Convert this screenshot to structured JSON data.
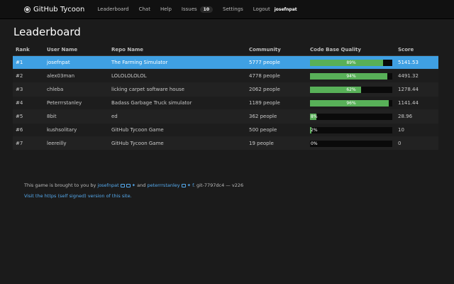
{
  "nav": {
    "brand": "GitHub Tycoon",
    "leaderboard": "Leaderboard",
    "chat": "Chat",
    "help": "Help",
    "issues": "Issues",
    "issues_count": "10",
    "settings": "Settings",
    "logout": "Logout",
    "username": "josefnpat"
  },
  "page_title": "Leaderboard",
  "table": {
    "headers": [
      "Rank",
      "User Name",
      "Repo Name",
      "Community",
      "Code Base Quality",
      "Score"
    ],
    "rows": [
      {
        "rank": "#1",
        "user": "josefnpat",
        "repo": "The Farming Simulator",
        "community": "5777 people",
        "quality": 89,
        "quality_label": "89%",
        "score": "5141.53"
      },
      {
        "rank": "#2",
        "user": "alex03man",
        "repo": "LOLOLOLOLOL",
        "community": "4778 people",
        "quality": 94,
        "quality_label": "94%",
        "score": "4491.32"
      },
      {
        "rank": "#3",
        "user": "chleba",
        "repo": "licking carpet software house",
        "community": "2062 people",
        "quality": 62,
        "quality_label": "62%",
        "score": "1278.44"
      },
      {
        "rank": "#4",
        "user": "Peterrrstanley",
        "repo": "Badass Garbage Truck simulator",
        "community": "1189 people",
        "quality": 96,
        "quality_label": "96%",
        "score": "1141.44"
      },
      {
        "rank": "#5",
        "user": "8bit",
        "repo": "ed",
        "community": "362 people",
        "quality": 8,
        "quality_label": "8%",
        "score": "28.96"
      },
      {
        "rank": "#6",
        "user": "kushsolitary",
        "repo": "GitHub Tycoon Game",
        "community": "500 people",
        "quality": 2,
        "quality_label": "2%",
        "score": "10"
      },
      {
        "rank": "#7",
        "user": "leereilly",
        "repo": "GitHub Tycoon Game",
        "community": "19 people",
        "quality": 0,
        "quality_label": "0%",
        "score": "0"
      }
    ]
  },
  "footer": {
    "prefix": "This game is brought to you by",
    "author1": "josefnpat",
    "and": "and",
    "author2": "peterrrstanley",
    "facebook": "f",
    "version": ". git-7797dc4 — v226",
    "link": "Visit the https (self signed) version of this site."
  }
}
